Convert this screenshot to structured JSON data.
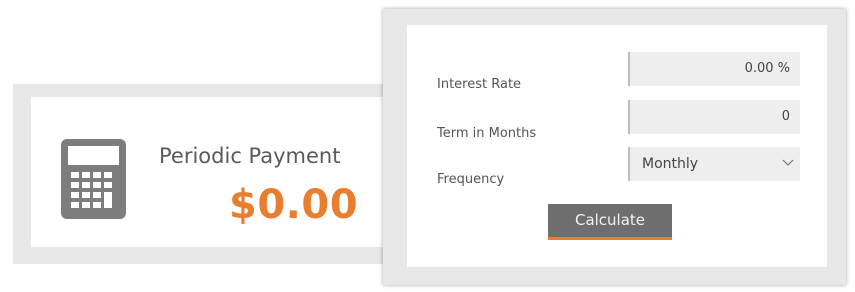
{
  "result": {
    "label": "Periodic Payment",
    "amount": "$0.00",
    "icon": "calculator-icon"
  },
  "form": {
    "interest_rate": {
      "label": "Interest Rate",
      "value": "0.00 %"
    },
    "term": {
      "label": "Term in Months",
      "value": "0"
    },
    "frequency": {
      "label": "Frequency",
      "value": "Monthly",
      "icon": "chevron-down-icon"
    },
    "calculate_label": "Calculate"
  },
  "colors": {
    "accent": "#e87e2e",
    "button": "#6e6e6e",
    "panel": "#e7e7e7"
  }
}
